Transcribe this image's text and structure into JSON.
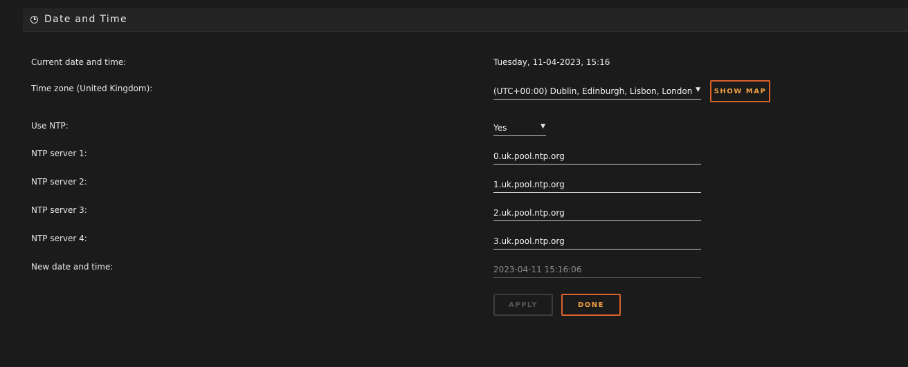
{
  "panel": {
    "title": "Date and Time",
    "icon": "clock-icon"
  },
  "rows": {
    "current_label": "Current date and time:",
    "current_value": "Tuesday, 11-04-2023, 15:16",
    "timezone_label": "Time zone (United Kingdom):",
    "timezone_value": "(UTC+00:00) Dublin, Edinburgh, Lisbon, London",
    "show_map": "SHOW MAP",
    "ntp_label": "Use NTP:",
    "ntp_value": "Yes",
    "ntp1_label": "NTP server 1:",
    "ntp1_value": "0.uk.pool.ntp.org",
    "ntp2_label": "NTP server 2:",
    "ntp2_value": "1.uk.pool.ntp.org",
    "ntp3_label": "NTP server 3:",
    "ntp3_value": "2.uk.pool.ntp.org",
    "ntp4_label": "NTP server 4:",
    "ntp4_value": "3.uk.pool.ntp.org",
    "newdate_label": "New date and time:",
    "newdate_value": "2023-04-11 15:16:06"
  },
  "buttons": {
    "apply": "APPLY",
    "done": "DONE"
  },
  "colors": {
    "accent_border": "#d9622b",
    "accent_text": "#f0a043",
    "background": "#1b1b1b",
    "header": "#242424"
  }
}
